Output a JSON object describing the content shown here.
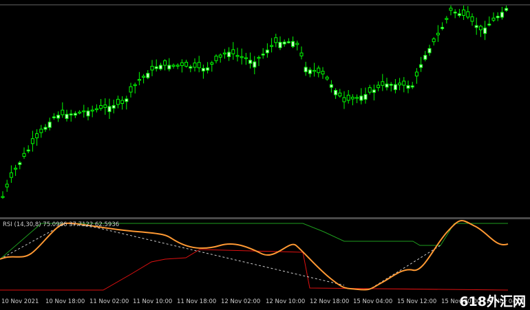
{
  "colors": {
    "background": "#000000",
    "bull_candle": "#00ff00",
    "bull_body": "#ccffcc",
    "rsi_main": "#ff9933",
    "rsi_upper": "#1e9e1e",
    "rsi_lower": "#e01010",
    "trendline": "#cccccc",
    "text": "#cfcfcf"
  },
  "indicator": {
    "label": "RSI (14,30,8) 75.0986 37.7122 62.5936"
  },
  "time_axis": {
    "ticks": [
      "10 Nov 2021",
      "10 Nov 18:00",
      "11 Nov 02:00",
      "11 Nov 10:00",
      "11 Nov 18:00",
      "12 Nov 02:00",
      "12 Nov 10:00",
      "12 Nov 18:00",
      "15 Nov 04:00",
      "15 Nov 12:00",
      "15 Nov 20:00",
      "16 Nov 04:00"
    ]
  },
  "watermark": "618外汇网",
  "chart_data": {
    "type": "candlestick",
    "rsi": {
      "value": 75.0986,
      "upper": 37.7122,
      "lower": 62.5936
    }
  }
}
